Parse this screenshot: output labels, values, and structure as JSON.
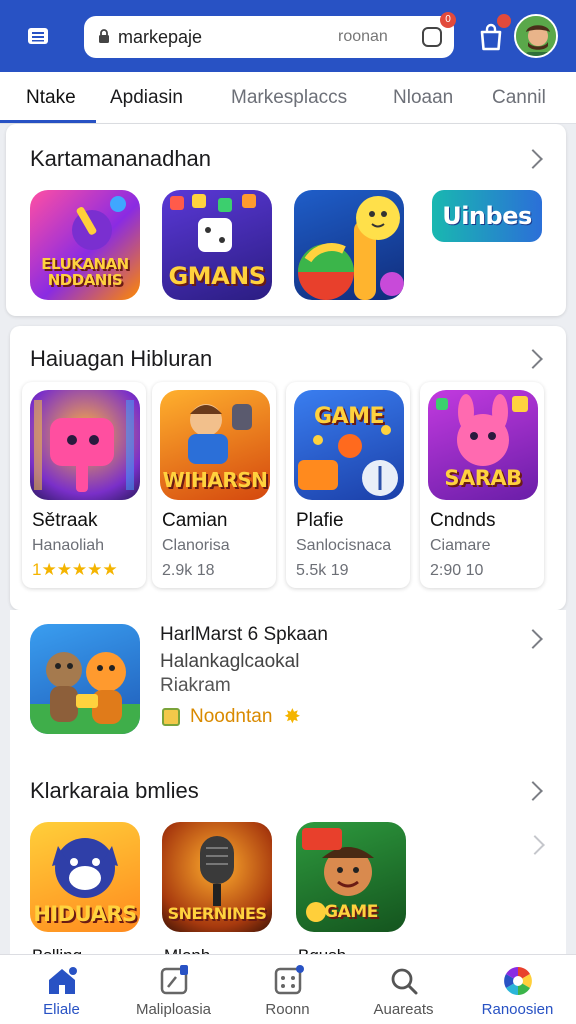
{
  "browser": {
    "url": "markepaje",
    "url_meta": "roonan",
    "tab_badge": "0"
  },
  "tabs": [
    {
      "label": "Ntake",
      "active": true
    },
    {
      "label": "Apdiasin",
      "active": false
    },
    {
      "label": "Markesplaccs",
      "active": false
    },
    {
      "label": "Nloaan",
      "active": false
    },
    {
      "label": "Cannil",
      "active": false
    }
  ],
  "section1": {
    "title": "Kartamananadhan",
    "tiles": [
      {
        "art": "ELUKANAN NDDANIS",
        "icon": "puzzle-app-icon"
      },
      {
        "art": "GMANS",
        "icon": "dice-game-icon"
      },
      {
        "art": "",
        "icon": "balloon-character-icon"
      },
      {
        "art": "Uinbes",
        "icon": "uinbes-logo-icon"
      }
    ]
  },
  "section2": {
    "title": "Haiuagan Hibluran",
    "apps": [
      {
        "name": "Sětraak",
        "sub": "Hanaoliah",
        "stat": "",
        "stars": "1★★★★★",
        "art": "",
        "icon": "gamepad-character-icon"
      },
      {
        "name": "Camian",
        "sub": "Clanorisa",
        "stat": "2.9k 18",
        "stars": "",
        "art": "WIHARSN",
        "icon": "hero-game-icon"
      },
      {
        "name": "Plafie",
        "sub": "Sanlocisnaca",
        "stat": "5.5k 19",
        "stars": "",
        "art": "GAME",
        "icon": "candy-game-icon"
      },
      {
        "name": "Cndnds",
        "sub": "Ciamare",
        "stat": "2:90 10",
        "stars": "",
        "art": "SARAB",
        "icon": "bunny-game-icon"
      }
    ]
  },
  "feature": {
    "title": "HarlMarst 6 Spkaan",
    "line1": "Halankaglcaokal",
    "line2": "Riakram",
    "tag": "Noodntan",
    "icon": "animal-friends-icon"
  },
  "section3": {
    "title": "Klarkaraia bmlies",
    "tiles": [
      {
        "art": "HIDUARS",
        "icon": "panther-game-icon"
      },
      {
        "art": "SNERNINES",
        "icon": "microphone-game-icon"
      },
      {
        "art": "GAME",
        "icon": "pirate-game-icon"
      }
    ],
    "partial_labels": [
      "Bslling",
      "Mlonh",
      "Bgush"
    ]
  },
  "bottom_nav": [
    {
      "label": "Eliale",
      "icon": "home-icon",
      "active": true
    },
    {
      "label": "Maliploasia",
      "icon": "apps-icon",
      "active": false
    },
    {
      "label": "Roonn",
      "icon": "grid-icon",
      "active": false
    },
    {
      "label": "Auareats",
      "icon": "search-icon",
      "active": false
    },
    {
      "label": "Ranoosien",
      "icon": "color-wheel-icon",
      "active": true
    }
  ],
  "colors": {
    "brand_blue": "#2852c4",
    "badge_red": "#e24a3b",
    "star_yellow": "#f4b400"
  }
}
